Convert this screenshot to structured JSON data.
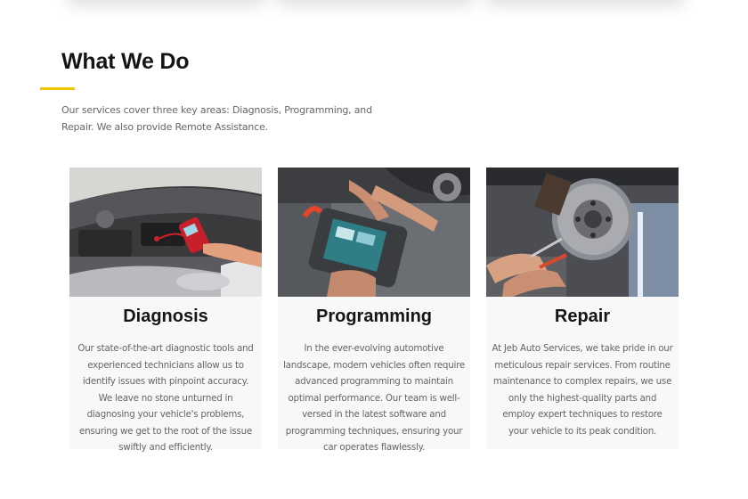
{
  "colors": {
    "accent": "#f5c400",
    "heading": "#151515",
    "body_text": "#666666",
    "card_background": "#f8f8f9"
  },
  "section": {
    "title": "What We Do",
    "intro": "Our services cover three key areas: Diagnosis, Programming, and Repair. We also provide Remote Assistance."
  },
  "services": [
    {
      "title": "Diagnosis",
      "image_icon": "engine-diagnostic-tool-photo",
      "description": "Our state-of-the-art diagnostic tools and experienced technicians allow us to identify issues with pinpoint accuracy. We leave no stone unturned in diagnosing your vehicle's problems, ensuring we get to the root of the issue swiftly and efficiently."
    },
    {
      "title": "Programming",
      "image_icon": "programming-tablet-photo",
      "description": "In the ever-evolving automotive landscape, modern vehicles often require advanced programming to maintain optimal performance. Our team is well-versed in the latest software and programming techniques, ensuring your car operates flawlessly."
    },
    {
      "title": "Repair",
      "image_icon": "brake-disc-repair-photo",
      "description": "At Jeb Auto Services, we take pride in our meticulous repair services. From routine maintenance to complex repairs, we use only the highest-quality parts and employ expert techniques to restore your vehicle to its peak condition."
    }
  ]
}
